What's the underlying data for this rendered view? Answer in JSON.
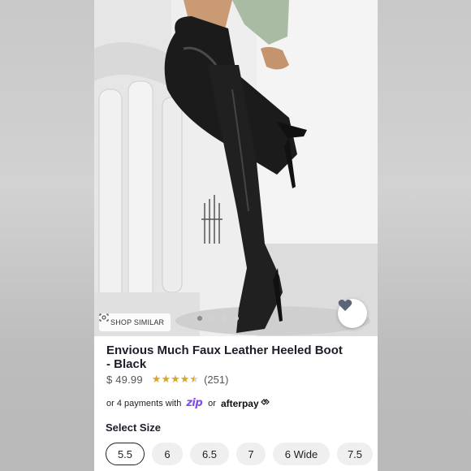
{
  "product": {
    "title_line1": "Envious Much Faux Leather Heeled Boot",
    "title_line2": "- Black",
    "price": "$ 49.99",
    "rating_stars": 4.5,
    "rating_count": "(251)"
  },
  "photo": {
    "shop_similar_label": "SHOP SIMILAR",
    "image_count": 4,
    "active_index": 0
  },
  "payments": {
    "prefix": "or 4 payments with",
    "zip_label": "zip",
    "or_label": "or",
    "afterpay_label": "afterpay"
  },
  "size_section": {
    "label": "Select Size",
    "options": [
      "5.5",
      "6",
      "6.5",
      "7",
      "6 Wide",
      "7.5"
    ],
    "selected": "5.5"
  },
  "colors": {
    "star": "#d4a62a",
    "zip_accent": "#7d4cf0",
    "heart": "#5c6478"
  },
  "icons": {
    "favorite": "heart-icon",
    "shop_similar": "camera-scan-icon",
    "afterpay_mark": "afterpay-arrows-icon"
  }
}
